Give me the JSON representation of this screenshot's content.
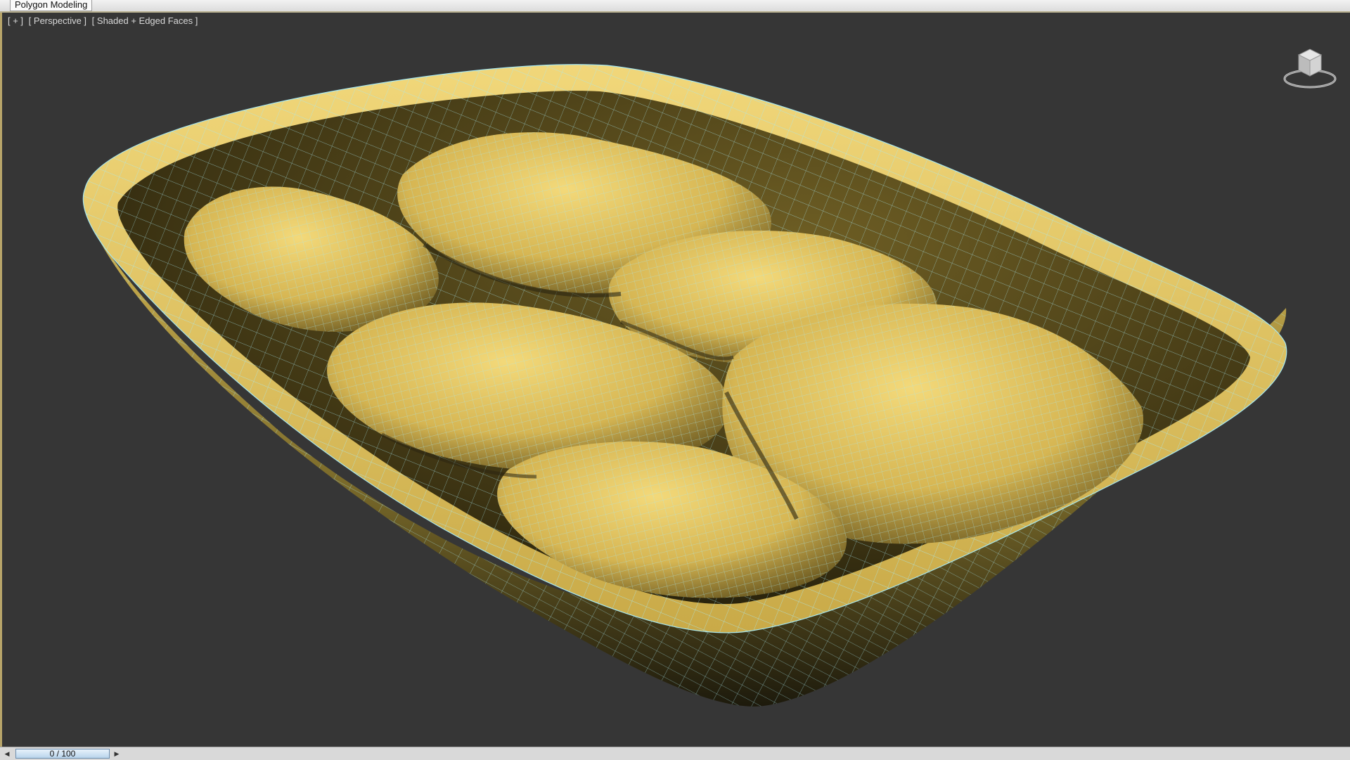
{
  "ribbon": {
    "active_tab": "Polygon Modeling"
  },
  "viewport": {
    "labels": [
      "[ + ]",
      "[ Perspective ]",
      "[ Shaded + Edged Faces ]"
    ]
  },
  "scene": {
    "object": "tray with food mesh",
    "mesh_color": "#e6c55c",
    "wire_color": "#a8e8f0",
    "background_color": "#363636"
  },
  "viewcube": {
    "icon": "viewcube-icon"
  },
  "timeline": {
    "frame_label": "0 / 100",
    "current_frame": 0,
    "total_frames": 100,
    "prev_icon": "arrow-left-icon",
    "next_icon": "arrow-right-icon"
  }
}
